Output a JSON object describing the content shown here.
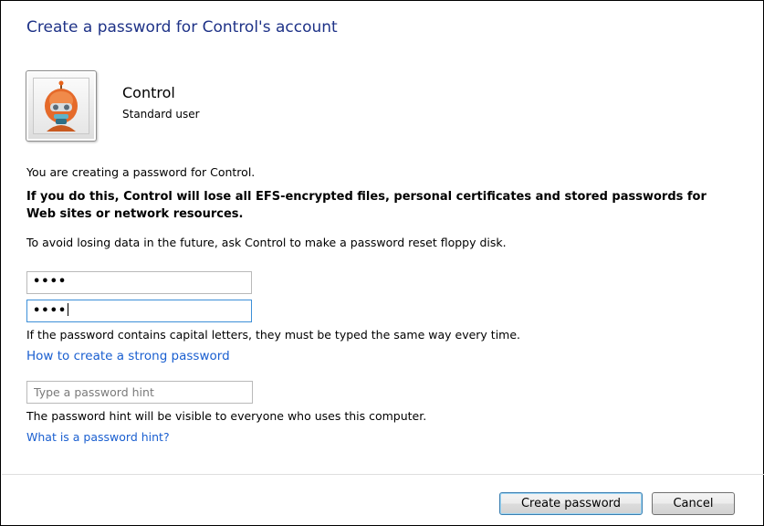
{
  "window": {
    "title": "Create a password for Control's account"
  },
  "account": {
    "name": "Control",
    "type": "Standard user",
    "avatar_icon": "robot-avatar-icon"
  },
  "messages": {
    "creating": "You are creating a password for Control.",
    "warning": "If you do this, Control will lose all EFS-encrypted files, personal certificates and stored passwords for Web sites or network resources.",
    "avoid": "To avoid losing data in the future, ask Control to make a password reset floppy disk.",
    "capital_note": "If the password contains capital letters, they must be typed the same way every time.",
    "hint_visible": "The password hint will be visible to everyone who uses this computer."
  },
  "fields": {
    "new_password_value": "••••",
    "confirm_password_value": "••••",
    "hint_placeholder": "Type a password hint",
    "hint_value": ""
  },
  "links": {
    "strong_password": "How to create a strong password",
    "what_is_hint": "What is a password hint?"
  },
  "buttons": {
    "create": "Create password",
    "cancel": "Cancel"
  },
  "colors": {
    "title": "#1e3287",
    "link": "#1a5fd0",
    "focus_border": "#3d8fd8"
  }
}
